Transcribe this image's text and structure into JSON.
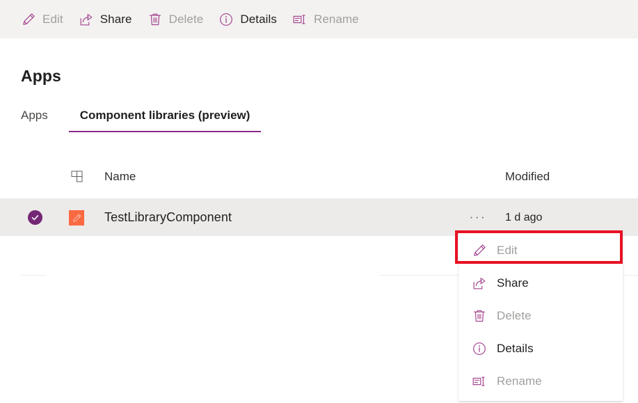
{
  "commandbar": {
    "items": [
      {
        "label": "Edit",
        "icon": "pencil-icon",
        "enabled": false
      },
      {
        "label": "Share",
        "icon": "share-icon",
        "enabled": true
      },
      {
        "label": "Delete",
        "icon": "trash-icon",
        "enabled": false
      },
      {
        "label": "Details",
        "icon": "info-icon",
        "enabled": true
      },
      {
        "label": "Rename",
        "icon": "rename-icon",
        "enabled": false
      }
    ]
  },
  "page": {
    "title": "Apps",
    "tabs": [
      {
        "label": "Apps",
        "active": false
      },
      {
        "label": "Component libraries (preview)",
        "active": true
      }
    ]
  },
  "list": {
    "columns": {
      "type_icon": "grid-layout-icon",
      "name": "Name",
      "modified": "Modified"
    },
    "rows": [
      {
        "selected": true,
        "check_icon": "checkmark-circle-icon",
        "app_icon": "orange-pencil-app-icon",
        "name": "TestLibraryComponent",
        "overflow": "···",
        "modified": "1 d ago"
      }
    ]
  },
  "context_menu": {
    "items": [
      {
        "label": "Edit",
        "icon": "pencil-icon",
        "enabled": false,
        "highlighted": true
      },
      {
        "label": "Share",
        "icon": "share-icon",
        "enabled": true,
        "highlighted": false
      },
      {
        "label": "Delete",
        "icon": "trash-icon",
        "enabled": false,
        "highlighted": false
      },
      {
        "label": "Details",
        "icon": "info-icon",
        "enabled": true,
        "highlighted": false
      },
      {
        "label": "Rename",
        "icon": "rename-icon",
        "enabled": false,
        "highlighted": false
      }
    ]
  },
  "colors": {
    "accent_purple": "#8a2a8c",
    "icon_purple": "#a4468f",
    "check_purple": "#742774",
    "app_icon_orange": "#f96a43",
    "highlight_red": "#e81123",
    "commandbar_bg": "#f3f2f1",
    "row_selected_bg": "#edebe9",
    "disabled_text": "#a19f9d"
  }
}
